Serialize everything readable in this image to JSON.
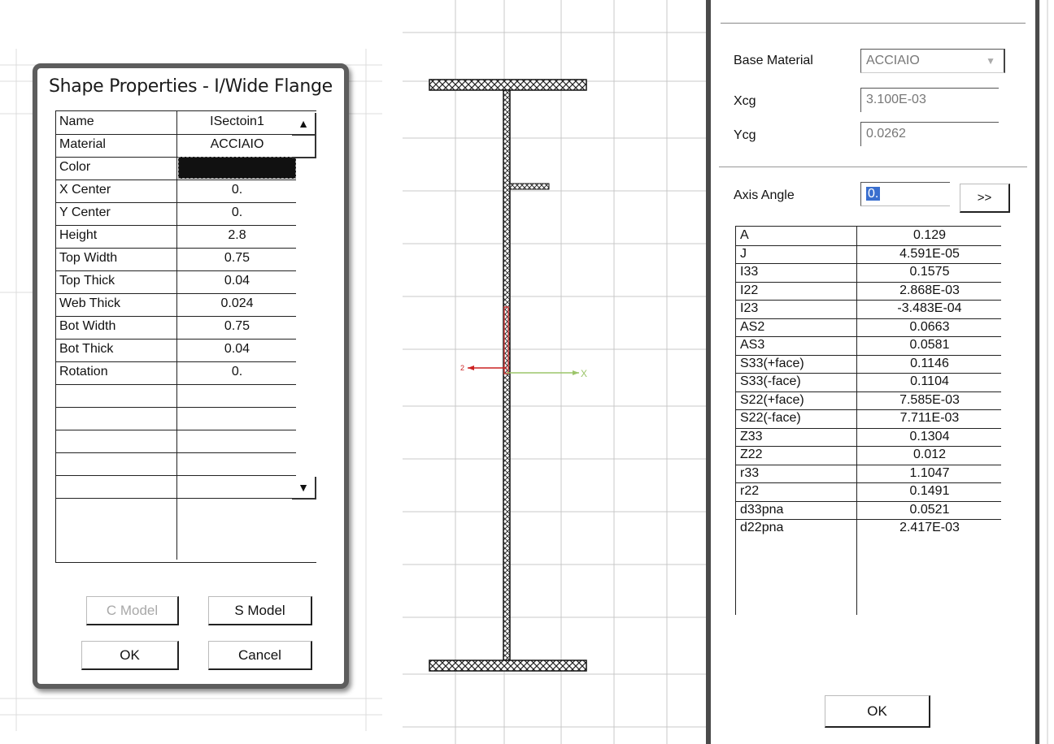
{
  "shape_dialog": {
    "title": "Shape Properties - I/Wide Flange",
    "properties": [
      {
        "name": "Name",
        "value": "ISectoin1"
      },
      {
        "name": "Material",
        "value": "ACCIAIO"
      },
      {
        "name": "Color",
        "value": ""
      },
      {
        "name": "X Center",
        "value": "0."
      },
      {
        "name": "Y Center",
        "value": "0."
      },
      {
        "name": "Height",
        "value": "2.8"
      },
      {
        "name": "Top Width",
        "value": "0.75"
      },
      {
        "name": "Top Thick",
        "value": "0.04"
      },
      {
        "name": "Web Thick",
        "value": "0.024"
      },
      {
        "name": "Bot Width",
        "value": "0.75"
      },
      {
        "name": "Bot Thick",
        "value": "0.04"
      },
      {
        "name": "Rotation",
        "value": "0."
      }
    ],
    "color_value": "#111111",
    "c_model_label": "C Model",
    "s_model_label": "S Model",
    "ok_label": "OK",
    "cancel_label": "Cancel"
  },
  "section_view": {
    "axis_x_label": "X",
    "axis_y_label": "2",
    "axis_colors": {
      "x": "#9cc56a",
      "y": "#cc2222"
    }
  },
  "properties_panel": {
    "base_material_label": "Base Material",
    "base_material_value": "ACCIAIO",
    "xcg_label": "Xcg",
    "xcg_value": "3.100E-03",
    "ycg_label": "Ycg",
    "ycg_value": "0.0262",
    "axis_angle_label": "Axis Angle",
    "axis_angle_value": "0.",
    "expand_label": ">>",
    "ok_label": "OK",
    "results": [
      {
        "name": "A",
        "value": "0.129"
      },
      {
        "name": "J",
        "value": "4.591E-05"
      },
      {
        "name": "I33",
        "value": "0.1575"
      },
      {
        "name": "I22",
        "value": "2.868E-03"
      },
      {
        "name": "I23",
        "value": "-3.483E-04"
      },
      {
        "name": "AS2",
        "value": "0.0663"
      },
      {
        "name": "AS3",
        "value": "0.0581"
      },
      {
        "name": "S33(+face)",
        "value": "0.1146"
      },
      {
        "name": "S33(-face)",
        "value": "0.1104"
      },
      {
        "name": "S22(+face)",
        "value": "7.585E-03"
      },
      {
        "name": "S22(-face)",
        "value": "7.711E-03"
      },
      {
        "name": "Z33",
        "value": "0.1304"
      },
      {
        "name": "Z22",
        "value": "0.012"
      },
      {
        "name": "r33",
        "value": "1.1047"
      },
      {
        "name": "r22",
        "value": "0.1491"
      },
      {
        "name": "d33pna",
        "value": "0.0521"
      },
      {
        "name": "d22pna",
        "value": "2.417E-03"
      }
    ]
  }
}
